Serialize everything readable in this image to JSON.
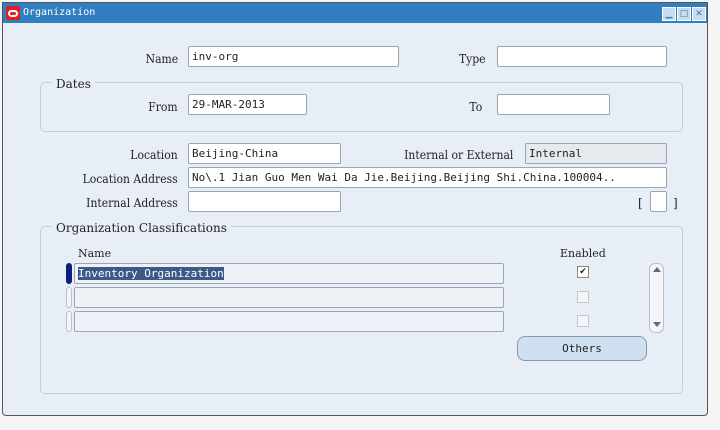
{
  "window": {
    "title": "Organization"
  },
  "header": {
    "name_label": "Name",
    "name_value": "inv-org",
    "type_label": "Type",
    "type_value": ""
  },
  "dates": {
    "legend": "Dates",
    "from_label": "From",
    "from_value": "29-MAR-2013",
    "to_label": "To",
    "to_value": ""
  },
  "location": {
    "location_label": "Location",
    "location_value": "Beijing-China",
    "int_ext_label": "Internal or External",
    "int_ext_value": "Internal",
    "address_label": "Location Address",
    "address_value": "No\\.1 Jian Guo Men Wai Da Jie.Beijing.Beijing Shi.China.100004..",
    "internal_address_label": "Internal Address",
    "internal_address_value": "",
    "bracket_open": "[",
    "bracket_close": "]"
  },
  "classifications": {
    "legend": "Organization Classifications",
    "name_header": "Name",
    "enabled_header": "Enabled",
    "rows": [
      {
        "name": "Inventory Organization",
        "enabled": true
      },
      {
        "name": "",
        "enabled": false
      },
      {
        "name": "",
        "enabled": false
      }
    ],
    "others_button": "Others",
    "check_mark": "✔"
  },
  "icons": {
    "minimize": "▁",
    "maximize": "□",
    "close": "✕"
  }
}
